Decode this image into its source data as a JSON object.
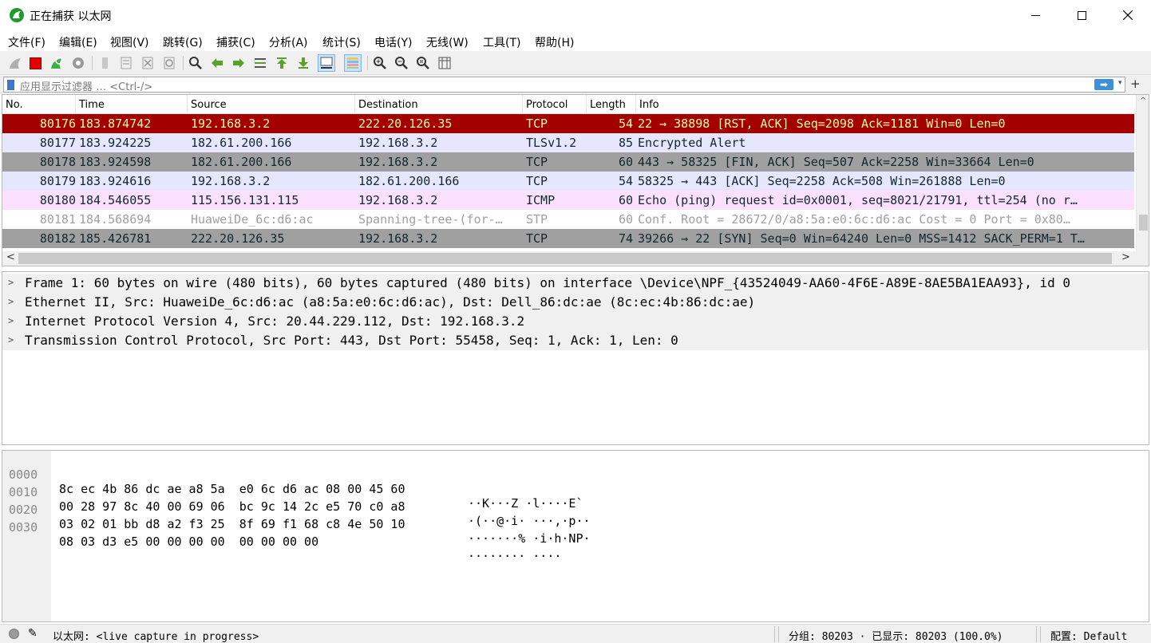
{
  "window": {
    "title": "正在捕获 以太网",
    "minimize_glyph": "—",
    "maximize_glyph": "☐",
    "close_glyph": "✕"
  },
  "menu": [
    {
      "label": "文件(F)"
    },
    {
      "label": "编辑(E)"
    },
    {
      "label": "视图(V)"
    },
    {
      "label": "跳转(G)"
    },
    {
      "label": "捕获(C)"
    },
    {
      "label": "分析(A)"
    },
    {
      "label": "统计(S)"
    },
    {
      "label": "电话(Y)"
    },
    {
      "label": "无线(W)"
    },
    {
      "label": "工具(T)"
    },
    {
      "label": "帮助(H)"
    }
  ],
  "toolbar": {
    "icons": [
      "shark-fin-start-icon",
      "stop-capture-icon",
      "restart-capture-icon",
      "capture-options-icon",
      "open-file-icon",
      "save-file-icon",
      "close-file-icon",
      "reload-file-icon",
      "find-packet-icon",
      "go-back-icon",
      "go-forward-icon",
      "go-to-packet-icon",
      "first-packet-icon",
      "last-packet-icon",
      "autoscroll-icon",
      "colorize-icon",
      "zoom-in-icon",
      "zoom-out-icon",
      "normal-size-icon",
      "resize-columns-icon"
    ]
  },
  "filter": {
    "placeholder": "应用显示过滤器 … <Ctrl-/>",
    "apply_arrow": "➡",
    "dropdown_glyph": "▾",
    "add_glyph": "+"
  },
  "packet_list": {
    "columns": [
      "No.",
      "Time",
      "Source",
      "Destination",
      "Protocol",
      "Length",
      "Info"
    ],
    "rows": [
      {
        "no": "80176",
        "time": "183.874742",
        "src": "192.168.3.2",
        "dst": "222.20.126.35",
        "proto": "TCP",
        "len": "54",
        "info": "22 → 38898 [RST, ACK] Seq=2098 Ack=1181 Win=0 Len=0",
        "bg": "#a40000",
        "fg": "#fffc9c"
      },
      {
        "no": "80177",
        "time": "183.924225",
        "src": "182.61.200.166",
        "dst": "192.168.3.2",
        "proto": "TLSv1.2",
        "len": "85",
        "info": "Encrypted Alert",
        "bg": "#e7e6ff",
        "fg": "#12272e"
      },
      {
        "no": "80178",
        "time": "183.924598",
        "src": "182.61.200.166",
        "dst": "192.168.3.2",
        "proto": "TCP",
        "len": "60",
        "info": "443 → 58325 [FIN, ACK] Seq=507 Ack=2258 Win=33664 Len=0",
        "bg": "#a0a0a0",
        "fg": "#12272e"
      },
      {
        "no": "80179",
        "time": "183.924616",
        "src": "192.168.3.2",
        "dst": "182.61.200.166",
        "proto": "TCP",
        "len": "54",
        "info": "58325 → 443 [ACK] Seq=2258 Ack=508 Win=261888 Len=0",
        "bg": "#e7e6ff",
        "fg": "#12272e"
      },
      {
        "no": "80180",
        "time": "184.546055",
        "src": "115.156.131.115",
        "dst": "192.168.3.2",
        "proto": "ICMP",
        "len": "60",
        "info": "Echo (ping) request  id=0x0001, seq=8021/21791, ttl=254 (no r…",
        "bg": "#fce0ff",
        "fg": "#12272e"
      },
      {
        "no": "80181",
        "time": "184.568694",
        "src": "HuaweiDe_6c:d6:ac",
        "dst": "Spanning-tree-(for-…",
        "proto": "STP",
        "len": "60",
        "info": "Conf. Root = 28672/0/a8:5a:e0:6c:d6:ac  Cost = 0  Port = 0x80…",
        "bg": "#ffffff",
        "fg": "#a0a0a0"
      },
      {
        "no": "80182",
        "time": "185.426781",
        "src": "222.20.126.35",
        "dst": "192.168.3.2",
        "proto": "TCP",
        "len": "74",
        "info": "39266 → 22 [SYN] Seq=0 Win=64240 Len=0 MSS=1412 SACK_PERM=1 T…",
        "bg": "#a0a0a0",
        "fg": "#12272e"
      }
    ],
    "scroll_left_glyph": "<",
    "scroll_right_glyph": ">",
    "scroll_up_glyph": "^",
    "scroll_down_glyph": "v"
  },
  "details": [
    {
      "arrow": ">",
      "text": "Frame 1: 60 bytes on wire (480 bits), 60 bytes captured (480 bits) on interface \\Device\\NPF_{43524049-AA60-4F6E-A89E-8AE5BA1EAA93}, id 0"
    },
    {
      "arrow": ">",
      "text": "Ethernet II, Src: HuaweiDe_6c:d6:ac (a8:5a:e0:6c:d6:ac), Dst: Dell_86:dc:ae (8c:ec:4b:86:dc:ae)"
    },
    {
      "arrow": ">",
      "text": "Internet Protocol Version 4, Src: 20.44.229.112, Dst: 192.168.3.2"
    },
    {
      "arrow": ">",
      "text": "Transmission Control Protocol, Src Port: 443, Dst Port: 55458, Seq: 1, Ack: 1, Len: 0"
    }
  ],
  "bytes": [
    {
      "offset": "0000",
      "hex": "8c ec 4b 86 dc ae a8 5a  e0 6c d6 ac 08 00 45 60",
      "ascii": "··K···Z ·l····E`"
    },
    {
      "offset": "0010",
      "hex": "00 28 97 8c 40 00 69 06  bc 9c 14 2c e5 70 c0 a8",
      "ascii": "·(··@·i· ···,·p··"
    },
    {
      "offset": "0020",
      "hex": "03 02 01 bb d8 a2 f3 25  8f 69 f1 68 c8 4e 50 10",
      "ascii": "·······% ·i·h·NP·"
    },
    {
      "offset": "0030",
      "hex": "08 03 d3 e5 00 00 00 00  00 00 00 00",
      "ascii": "········ ····"
    }
  ],
  "status": {
    "text": "以太网: <live capture in progress>",
    "packets": "分组: 80203 · 已显示: 80203 (100.0%)",
    "profile": "配置: Default",
    "edit_glyph": "✎"
  },
  "colors": {
    "accent_blue": "#3c8fd8",
    "rst_red": "#a40000",
    "tls_lavender": "#e7e6ff",
    "tcp_gray": "#a0a0a0",
    "icmp_pink": "#fce0ff"
  }
}
